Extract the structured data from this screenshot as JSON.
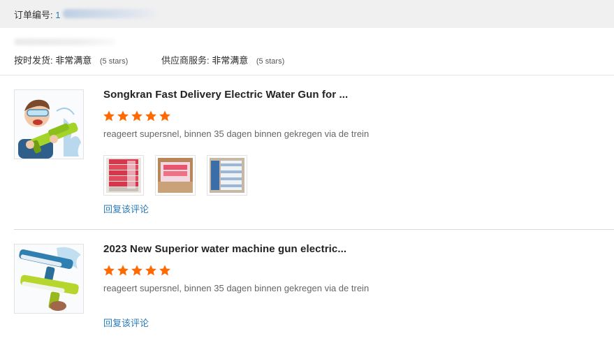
{
  "order": {
    "label": "订单编号:",
    "number_prefix": "1"
  },
  "ratings": {
    "ontime": {
      "label": "按时发货:",
      "value": "非常满意",
      "stars": "(5 stars)"
    },
    "service": {
      "label": "供应商服务:",
      "value": "非常满意",
      "stars": "(5 stars)"
    }
  },
  "reviews": [
    {
      "title": "Songkran Fast Delivery Electric Water Gun for ...",
      "rating": 5,
      "comment": "reageert supersnel, binnen 35 dagen binnen gekregen via de trein",
      "photo_count": 3,
      "reply_label": "回复该评论"
    },
    {
      "title": "2023 New Superior water machine gun electric...",
      "rating": 5,
      "comment": "reageert supersnel, binnen 35 dagen binnen gekregen via de trein",
      "photo_count": 0,
      "reply_label": "回复该评论"
    }
  ],
  "colors": {
    "star": "#ff6a00",
    "link": "#2a7ab8",
    "header_bg": "#f0f0f0"
  }
}
